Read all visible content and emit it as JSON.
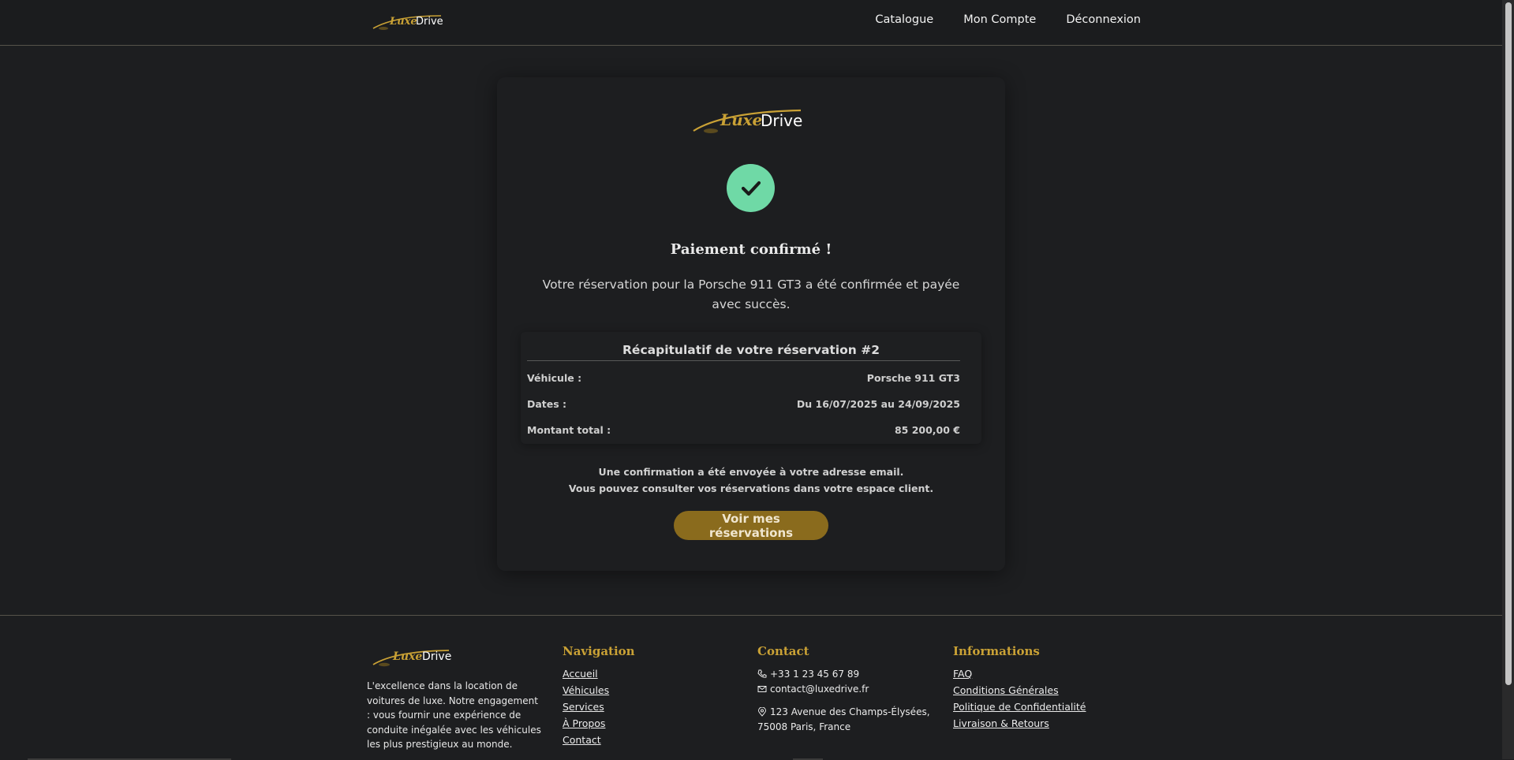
{
  "brand": {
    "word1": "Luxe",
    "word2": "Drive"
  },
  "nav": [
    {
      "label": "Catalogue"
    },
    {
      "label": "Mon Compte"
    },
    {
      "label": "Déconnexion"
    }
  ],
  "confirmation": {
    "title": "Paiement confirmé !",
    "lead": "Votre réservation pour la Porsche 911 GT3 a été confirmée et payée avec succès.",
    "summary_title": "Récapitulatif de votre réservation #2",
    "rows": [
      {
        "label": "Véhicule :",
        "value": "Porsche 911 GT3"
      },
      {
        "label": "Dates :",
        "value": "Du 16/07/2025 au 24/09/2025"
      },
      {
        "label": "Montant total :",
        "value": "85 200,00 €"
      }
    ],
    "note_line1": "Une confirmation a été envoyée à votre adresse email.",
    "note_line2": "Vous pouvez consulter vos réservations dans votre espace client.",
    "cta_label": "Voir mes réservations"
  },
  "footer": {
    "about": "L'excellence dans la location de voitures de luxe. Notre engagement : vous fournir une expérience de conduite inégalée avec les véhicules les plus prestigieux au monde.",
    "navigation": {
      "title": "Navigation",
      "links": [
        "Accueil",
        "Véhicules",
        "Services",
        "À Propos",
        "Contact"
      ]
    },
    "contact": {
      "title": "Contact",
      "phone": "+33 1 23 45 67 89",
      "email": "contact@luxedrive.fr",
      "address_line1": "123 Avenue des Champs-Élysées,",
      "address_line2": "75008 Paris, France"
    },
    "informations": {
      "title": "Informations",
      "links": [
        "FAQ",
        "Conditions Générales",
        "Politique de Confidentialité",
        "Livraison & Retours"
      ]
    }
  },
  "colors": {
    "gold": "#c9a135",
    "success": "#6fd9a6",
    "cta": "#8a6b1d",
    "background": "#1d1e20"
  }
}
